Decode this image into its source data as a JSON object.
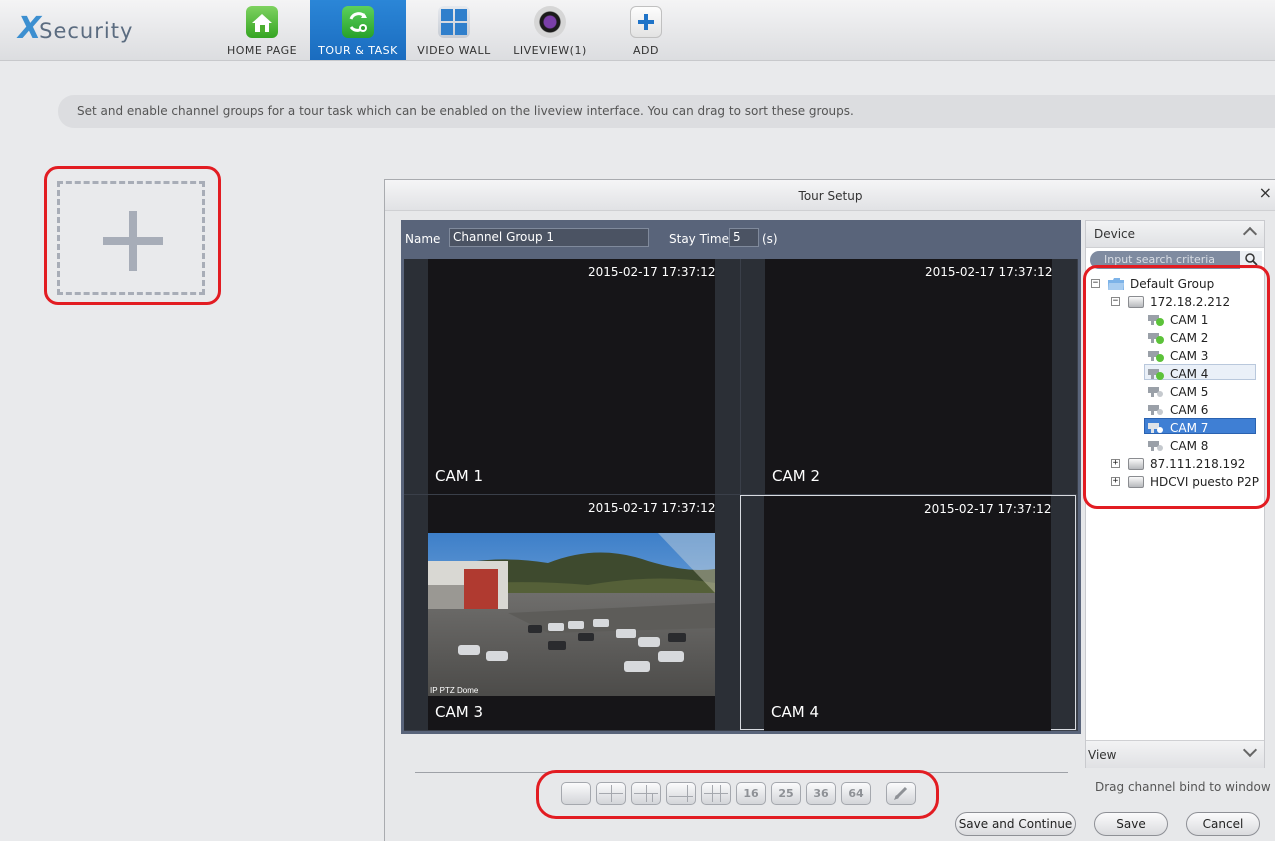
{
  "app": {
    "logo_x": "X",
    "logo_word": "Security"
  },
  "nav": [
    {
      "label": "HOME PAGE",
      "icon": "home-icon"
    },
    {
      "label": "TOUR & TASK",
      "icon": "tour-task-icon",
      "active": true
    },
    {
      "label": "VIDEO WALL",
      "icon": "video-wall-icon"
    },
    {
      "label": "LIVEVIEW(1)",
      "icon": "liveview-icon"
    },
    {
      "label": "ADD",
      "icon": "add-icon"
    }
  ],
  "tip": "Set and enable channel groups for a tour task which can be enabled on the liveview interface. You can drag to sort these groups.",
  "dialog": {
    "title": "Tour Setup",
    "close": "×",
    "name_label": "Name",
    "name_value": "Channel Group 1",
    "stay_label": "Stay Time",
    "stay_value": "5",
    "stay_unit": "(s)",
    "cells": [
      {
        "timestamp": "2015-02-17 17:37:12",
        "cam": "CAM 1"
      },
      {
        "timestamp": "2015-02-17 17:37:12",
        "cam": "CAM 2"
      },
      {
        "timestamp": "2015-02-17 17:37:12",
        "cam": "CAM 3",
        "overlay": "IP PTZ Dome"
      },
      {
        "timestamp": "2015-02-17 17:37:12",
        "cam": "CAM 4",
        "selected": true
      }
    ],
    "layouts": [
      "",
      "",
      "",
      "",
      "",
      "16",
      "25",
      "36",
      "64",
      ""
    ],
    "drag_tip": "Drag channel bind to window",
    "buttons": {
      "save_continue": "Save and Continue",
      "save": "Save",
      "cancel": "Cancel"
    }
  },
  "device": {
    "title": "Device",
    "search_placeholder": "Input search criteria",
    "view_title": "View",
    "tree": {
      "group": "Default Group",
      "device1": "172.18.2.212",
      "cams": [
        "CAM 1",
        "CAM 2",
        "CAM 3",
        "CAM 4",
        "CAM 5",
        "CAM 6",
        "CAM 7",
        "CAM 8"
      ],
      "device2": "87.111.218.192",
      "device3": "HDCVI puesto P2P"
    }
  },
  "colors": {
    "accent": "#1a6cbf",
    "highlight": "#e21c22",
    "selected_row": "#3f7fd4"
  }
}
